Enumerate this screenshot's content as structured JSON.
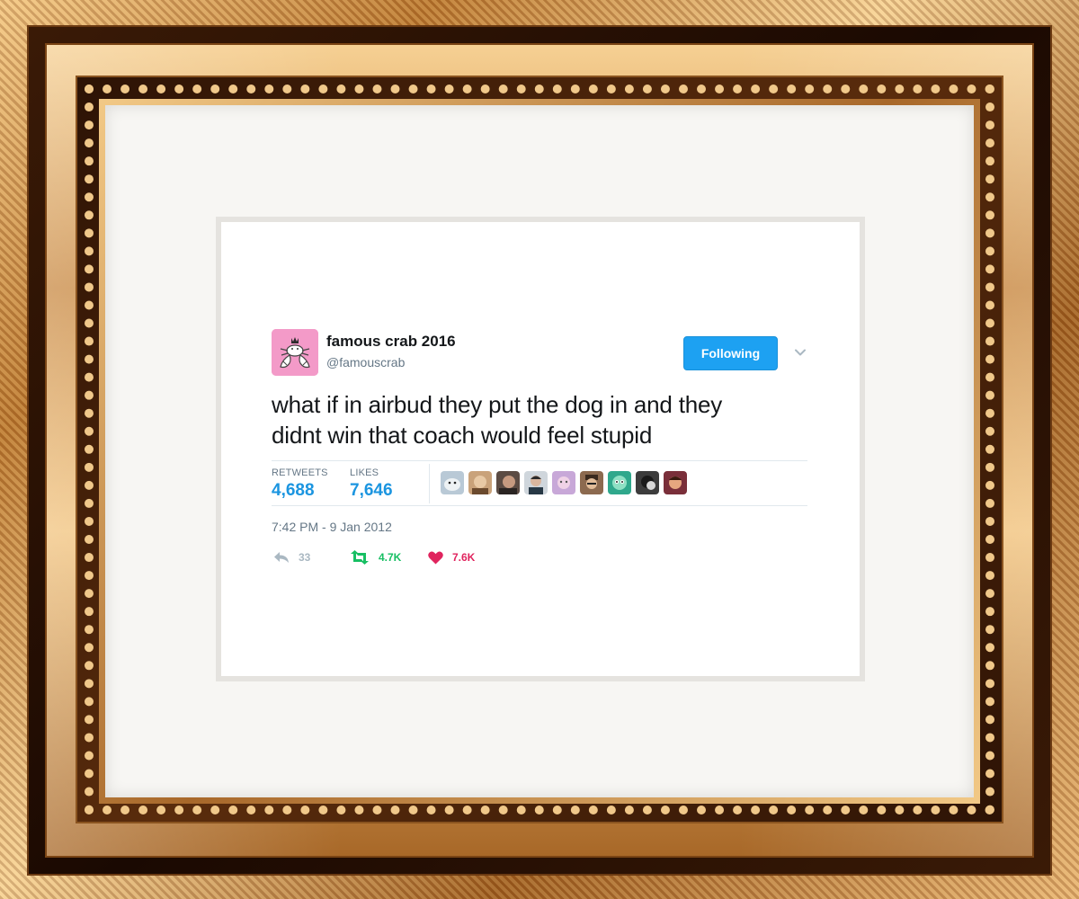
{
  "tweet": {
    "display_name": "famous crab 2016",
    "handle": "@famouscrab",
    "follow_label": "Following",
    "text_line1": "what if in airbud they put the dog in and they",
    "text_line2": "didnt win that coach would feel stupid",
    "stats": {
      "retweets_label": "RETWEETS",
      "retweets_value": "4,688",
      "likes_label": "LIKES",
      "likes_value": "7,646"
    },
    "timestamp": "7:42 PM - 9 Jan 2012",
    "actions": {
      "reply_count": "33",
      "retweet_count": "4.7K",
      "like_count": "7.6K"
    },
    "liker_avatar_count": 9
  },
  "icons": {
    "reply": "reply-icon",
    "retweet": "retweet-icon",
    "like": "heart-icon",
    "chevron": "chevron-down-icon"
  },
  "colors": {
    "follow_button": "#1da1f2",
    "stat_value": "#1b95e0",
    "retweet": "#17bf63",
    "like": "#e0245e",
    "muted": "#657786",
    "avatar_bg": "#f39ac8"
  }
}
